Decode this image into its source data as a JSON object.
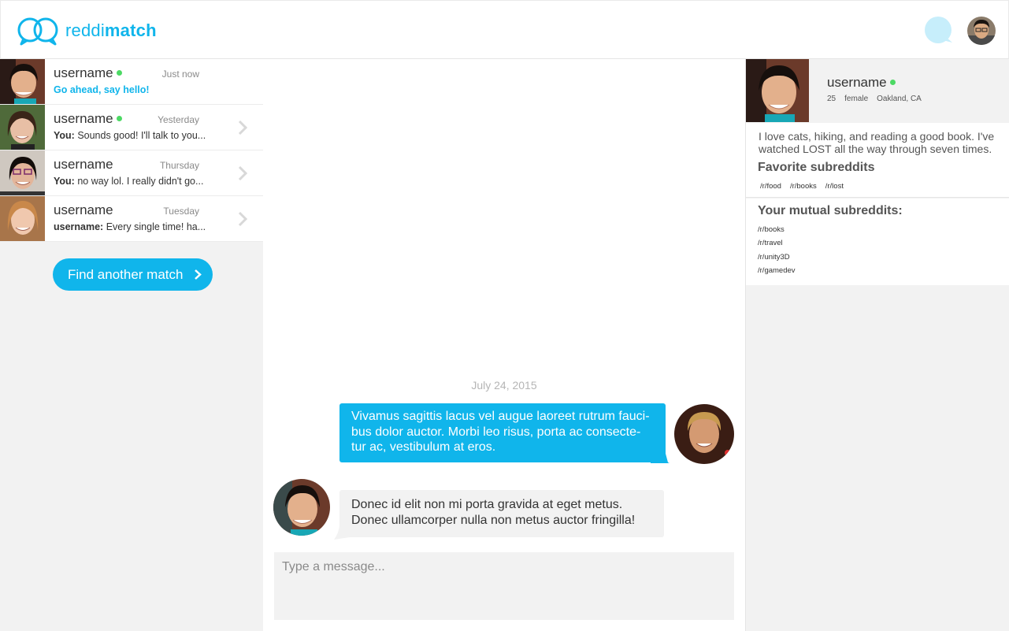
{
  "app": {
    "logo_plain": "reddi",
    "logo_bold": "match",
    "accent_color": "#10b5eb",
    "online_color": "#4cd964"
  },
  "conversations": [
    {
      "name": "username",
      "online": true,
      "time": "Just now",
      "preview_prefix": "",
      "preview": "Go ahead, say hello!",
      "highlight": true
    },
    {
      "name": "username",
      "online": true,
      "time": "Yesterday",
      "preview_prefix": "You:",
      "preview": " Sounds good! I'll talk to you...",
      "highlight": false
    },
    {
      "name": "username",
      "online": false,
      "time": "Thursday",
      "preview_prefix": "You:",
      "preview": " no way lol. I really didn't go...",
      "highlight": false
    },
    {
      "name": "username",
      "online": false,
      "time": "Tuesday",
      "preview_prefix": "username:",
      "preview": " Every single time! ha...",
      "highlight": false
    }
  ],
  "find_match_label": "Find another match",
  "chat": {
    "date": "July 24, 2015",
    "outgoing": "Vivamus sagittis lacus vel augue laoreet rutrum fauci-bus dolor auctor. Morbi leo risus, porta ac consecte-tur ac, vestibulum at eros.",
    "incoming": "Donec id elit non mi porta gravida at eget metus. Donec ullamcorper nulla non metus auctor fringilla!",
    "input_placeholder": "Type a message..."
  },
  "profile": {
    "name": "username",
    "age": "25",
    "gender": "female",
    "location": "Oakland, CA",
    "bio": "I love cats, hiking, and reading a good book. I've watched LOST all the way through seven times.",
    "favorites_title": "Favorite subreddits",
    "favorites": [
      "/r/food",
      "/r/books",
      "/r/lost"
    ],
    "mutual_title": "Your mutual subreddits:",
    "mutual": [
      "/r/books",
      "/r/travel",
      "/r/unity3D",
      "/r/gamedev"
    ]
  }
}
